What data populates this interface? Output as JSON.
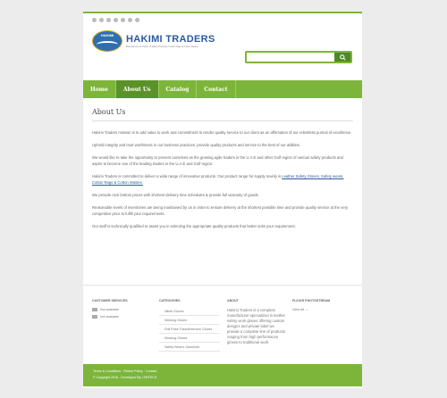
{
  "header": {
    "social_icons": [
      "facebook-icon",
      "twitter-icon",
      "linkedin-icon",
      "google-plus-icon",
      "rss-icon",
      "pinterest-icon",
      "youtube-icon"
    ],
    "logo_badge": "HAKIMI",
    "logo_name": "HAKIMI TRADERS",
    "logo_tagline": "Manufacturer & Trader of Safety Products, Cotton Rags & Cotton Wastes",
    "search_placeholder": ""
  },
  "nav": {
    "items": [
      "Home",
      "About Us",
      "Catalog",
      "Contact"
    ],
    "active": "About Us"
  },
  "main": {
    "title": "About Us",
    "p1": "Hakimi Traders mission is to add value to work and commitment to render quality service to our client as an affirmation of our relentless pursuit of excellence.",
    "p2": "Uphold integrity and trust worthiness in our business practices, provide quality products and service to the best of our abilities.",
    "p3": "We would like to take the opportunity to present ourselves as the growing agile traders in the U.A.E and other Gulf region of various safety products and aspire to become one of the leading traders in the U.A.E and Gulf region.",
    "p4_prefix": "Hakimi Traders is committed to deliver a wide range of innovative products. Our product range for supply mainly is ",
    "p4_link": "Leather Safety Gloves, Safety wears, Cotton Rags & Cotton Wastes.",
    "p5": "We provide rock bottom prices with shortest delivery time schedules & provide full warranty of goods.",
    "p6": "Reasonable levels of inventories are being maintained by us in order to ensure delivery at the shortest possible time and provide quality service at the very competitive price to fulfill your requirements.",
    "p7": "Our staff is technically qualified to assist you in selecting the appropriate quality products that better suits your requirement."
  },
  "footer": {
    "customer_services": {
      "heading": "CUSTOMER SERVICES",
      "lines": [
        "Not available",
        "Not available"
      ]
    },
    "categories": {
      "heading": "CATEGORIES",
      "items": [
        "Nitrile Gloves",
        "Welding Gloves",
        "Drill Rubs Fused/Interlock Gloves",
        "Working Gloves",
        "Safety Wear's Garments"
      ]
    },
    "about": {
      "heading": "ABOUT",
      "text": "Hakimi Traders is a complete manufacturer specialized in leather safety work gloves offering custom designs and private label we provide a complete line of products ranging from high performance gloves to traditional work."
    },
    "flickr": {
      "heading": "FLICKR PHOTOSTREAM",
      "link": "View All →"
    }
  },
  "bottom": {
    "links": "Terms & Conditions · Return Policy · Contact",
    "copyright": "© Copyright 2016 - Developed By | SNTECH"
  },
  "colors": {
    "accent": "#7cb53a",
    "accent_dark": "#4f8a1e",
    "brand_blue": "#2a5aa0"
  }
}
